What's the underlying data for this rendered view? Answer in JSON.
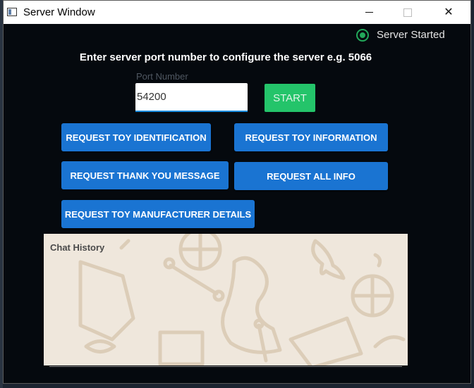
{
  "window": {
    "title": "Server Window",
    "controls": {
      "minimize": "minimize",
      "maximize": "maximize",
      "close": "✕"
    }
  },
  "status": {
    "text": "Server Started",
    "color": "#22a85a"
  },
  "heading": "Enter server port number to configure the server e.g. 5066",
  "port": {
    "label": "Port Number",
    "value": "54200"
  },
  "start_button": "START",
  "buttons": {
    "toy_identification": "REQUEST TOY IDENTIFICATION",
    "toy_information": "REQUEST TOY INFORMATION",
    "thank_you": "REQUEST THANK YOU MESSAGE",
    "all_info": "REQUEST ALL INFO",
    "manufacturer": "REQUEST TOY MANUFACTURER DETAILS"
  },
  "chat": {
    "title": "Chat History"
  },
  "colors": {
    "accent_blue": "#1a74d2",
    "start_green": "#24c46a",
    "background": "#05090e"
  }
}
